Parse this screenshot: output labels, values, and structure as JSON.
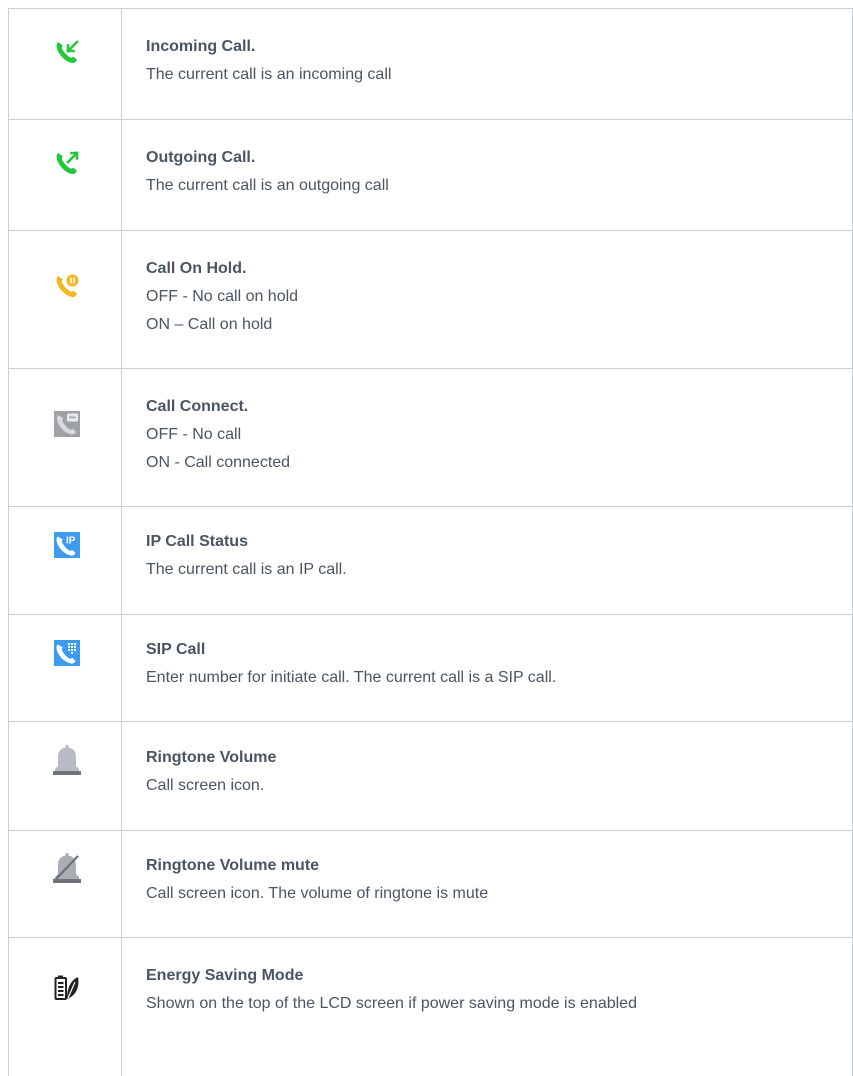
{
  "rows": [
    {
      "icon": "incoming-call-icon",
      "title": "Incoming Call.",
      "lines": [
        "The current call is an incoming call"
      ]
    },
    {
      "icon": "outgoing-call-icon",
      "title": "Outgoing Call.",
      "lines": [
        "The current call is an outgoing call"
      ]
    },
    {
      "icon": "call-on-hold-icon",
      "title": "Call On Hold.",
      "lines": [
        "OFF - No call on hold",
        "ON – Call on hold"
      ]
    },
    {
      "icon": "call-connect-icon",
      "title": "Call Connect.",
      "lines": [
        "OFF - No call",
        "ON - Call connected"
      ]
    },
    {
      "icon": "ip-call-status-icon",
      "title": "IP Call Status",
      "lines": [
        "The current call is an IP call."
      ]
    },
    {
      "icon": "sip-call-icon",
      "title": "SIP Call",
      "lines": [
        "Enter number for initiate call. The current call is a SIP call."
      ]
    },
    {
      "icon": "ringtone-volume-icon",
      "title": "Ringtone Volume",
      "lines": [
        "Call screen icon."
      ]
    },
    {
      "icon": "ringtone-mute-icon",
      "title": "Ringtone Volume mute",
      "lines": [
        "Call screen icon. The volume of ringtone is mute"
      ]
    },
    {
      "icon": "energy-saving-icon",
      "title": "Energy Saving Mode",
      "lines": [
        "Shown on the top of the LCD screen if power saving mode is enabled"
      ]
    }
  ],
  "colors": {
    "green": "#22c83a",
    "orange": "#f5b51e",
    "gray_icon": "#8f9399",
    "blue": "#3d9cf0",
    "bell": "#b7bcc4"
  }
}
